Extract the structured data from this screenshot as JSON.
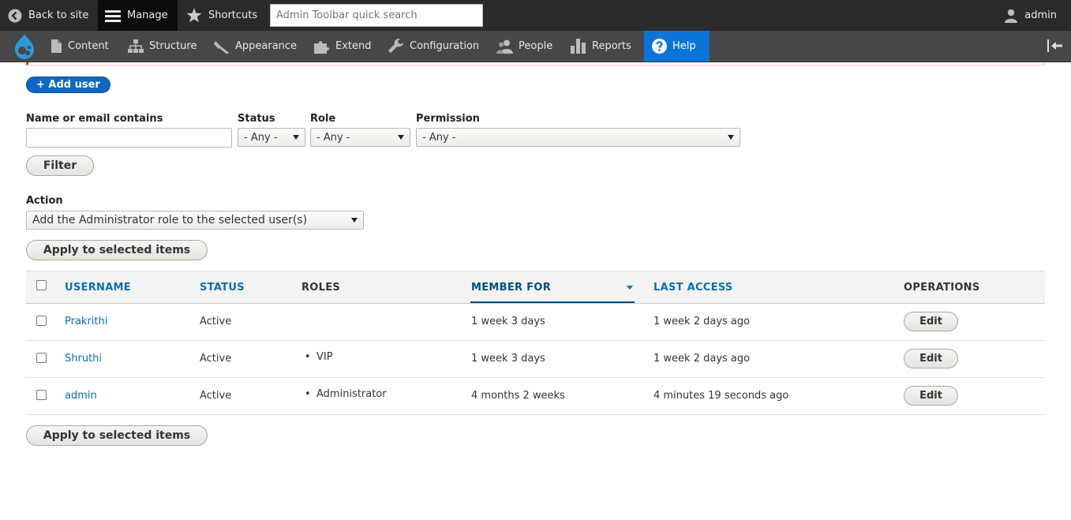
{
  "toolbar": {
    "back_label": "Back to site",
    "manage_label": "Manage",
    "shortcuts_label": "Shortcuts",
    "search_placeholder": "Admin Toolbar quick search",
    "user_label": "admin"
  },
  "tray": {
    "items": [
      {
        "label": "Content",
        "icon": "file-icon"
      },
      {
        "label": "Structure",
        "icon": "structure-icon"
      },
      {
        "label": "Appearance",
        "icon": "brush-icon"
      },
      {
        "label": "Extend",
        "icon": "puzzle-icon"
      },
      {
        "label": "Configuration",
        "icon": "wrench-icon"
      },
      {
        "label": "People",
        "icon": "people-icon"
      },
      {
        "label": "Reports",
        "icon": "bar-chart-icon"
      },
      {
        "label": "Help",
        "icon": "question-icon"
      }
    ],
    "active": "Help",
    "accent": "#0b74d6"
  },
  "page": {
    "add_user_label": "+ Add user",
    "filters": {
      "name_label": "Name or email contains",
      "name_value": "",
      "status_label": "Status",
      "status_value": "- Any -",
      "role_label": "Role",
      "role_value": "- Any -",
      "permission_label": "Permission",
      "permission_value": "- Any -",
      "filter_button": "Filter"
    },
    "action": {
      "label": "Action",
      "value": "Add the Administrator role to the selected user(s)",
      "apply_label": "Apply to selected items"
    },
    "table": {
      "headers": {
        "username": "USERNAME",
        "status": "STATUS",
        "roles": "ROLES",
        "member_for": "MEMBER FOR",
        "last_access": "LAST ACCESS",
        "operations": "OPERATIONS"
      },
      "sorted_by": "member_for",
      "rows": [
        {
          "username": "Prakrithi",
          "status": "Active",
          "roles": [],
          "member_for": "1 week 3 days",
          "last_access": "1 week 2 days ago",
          "operation": "Edit"
        },
        {
          "username": "Shruthi",
          "status": "Active",
          "roles": [
            "VIP"
          ],
          "member_for": "1 week 3 days",
          "last_access": "1 week 2 days ago",
          "operation": "Edit"
        },
        {
          "username": "admin",
          "status": "Active",
          "roles": [
            "Administrator"
          ],
          "member_for": "4 months 2 weeks",
          "last_access": "4 minutes 19 seconds ago",
          "operation": "Edit"
        }
      ]
    },
    "apply_bottom_label": "Apply to selected items"
  }
}
